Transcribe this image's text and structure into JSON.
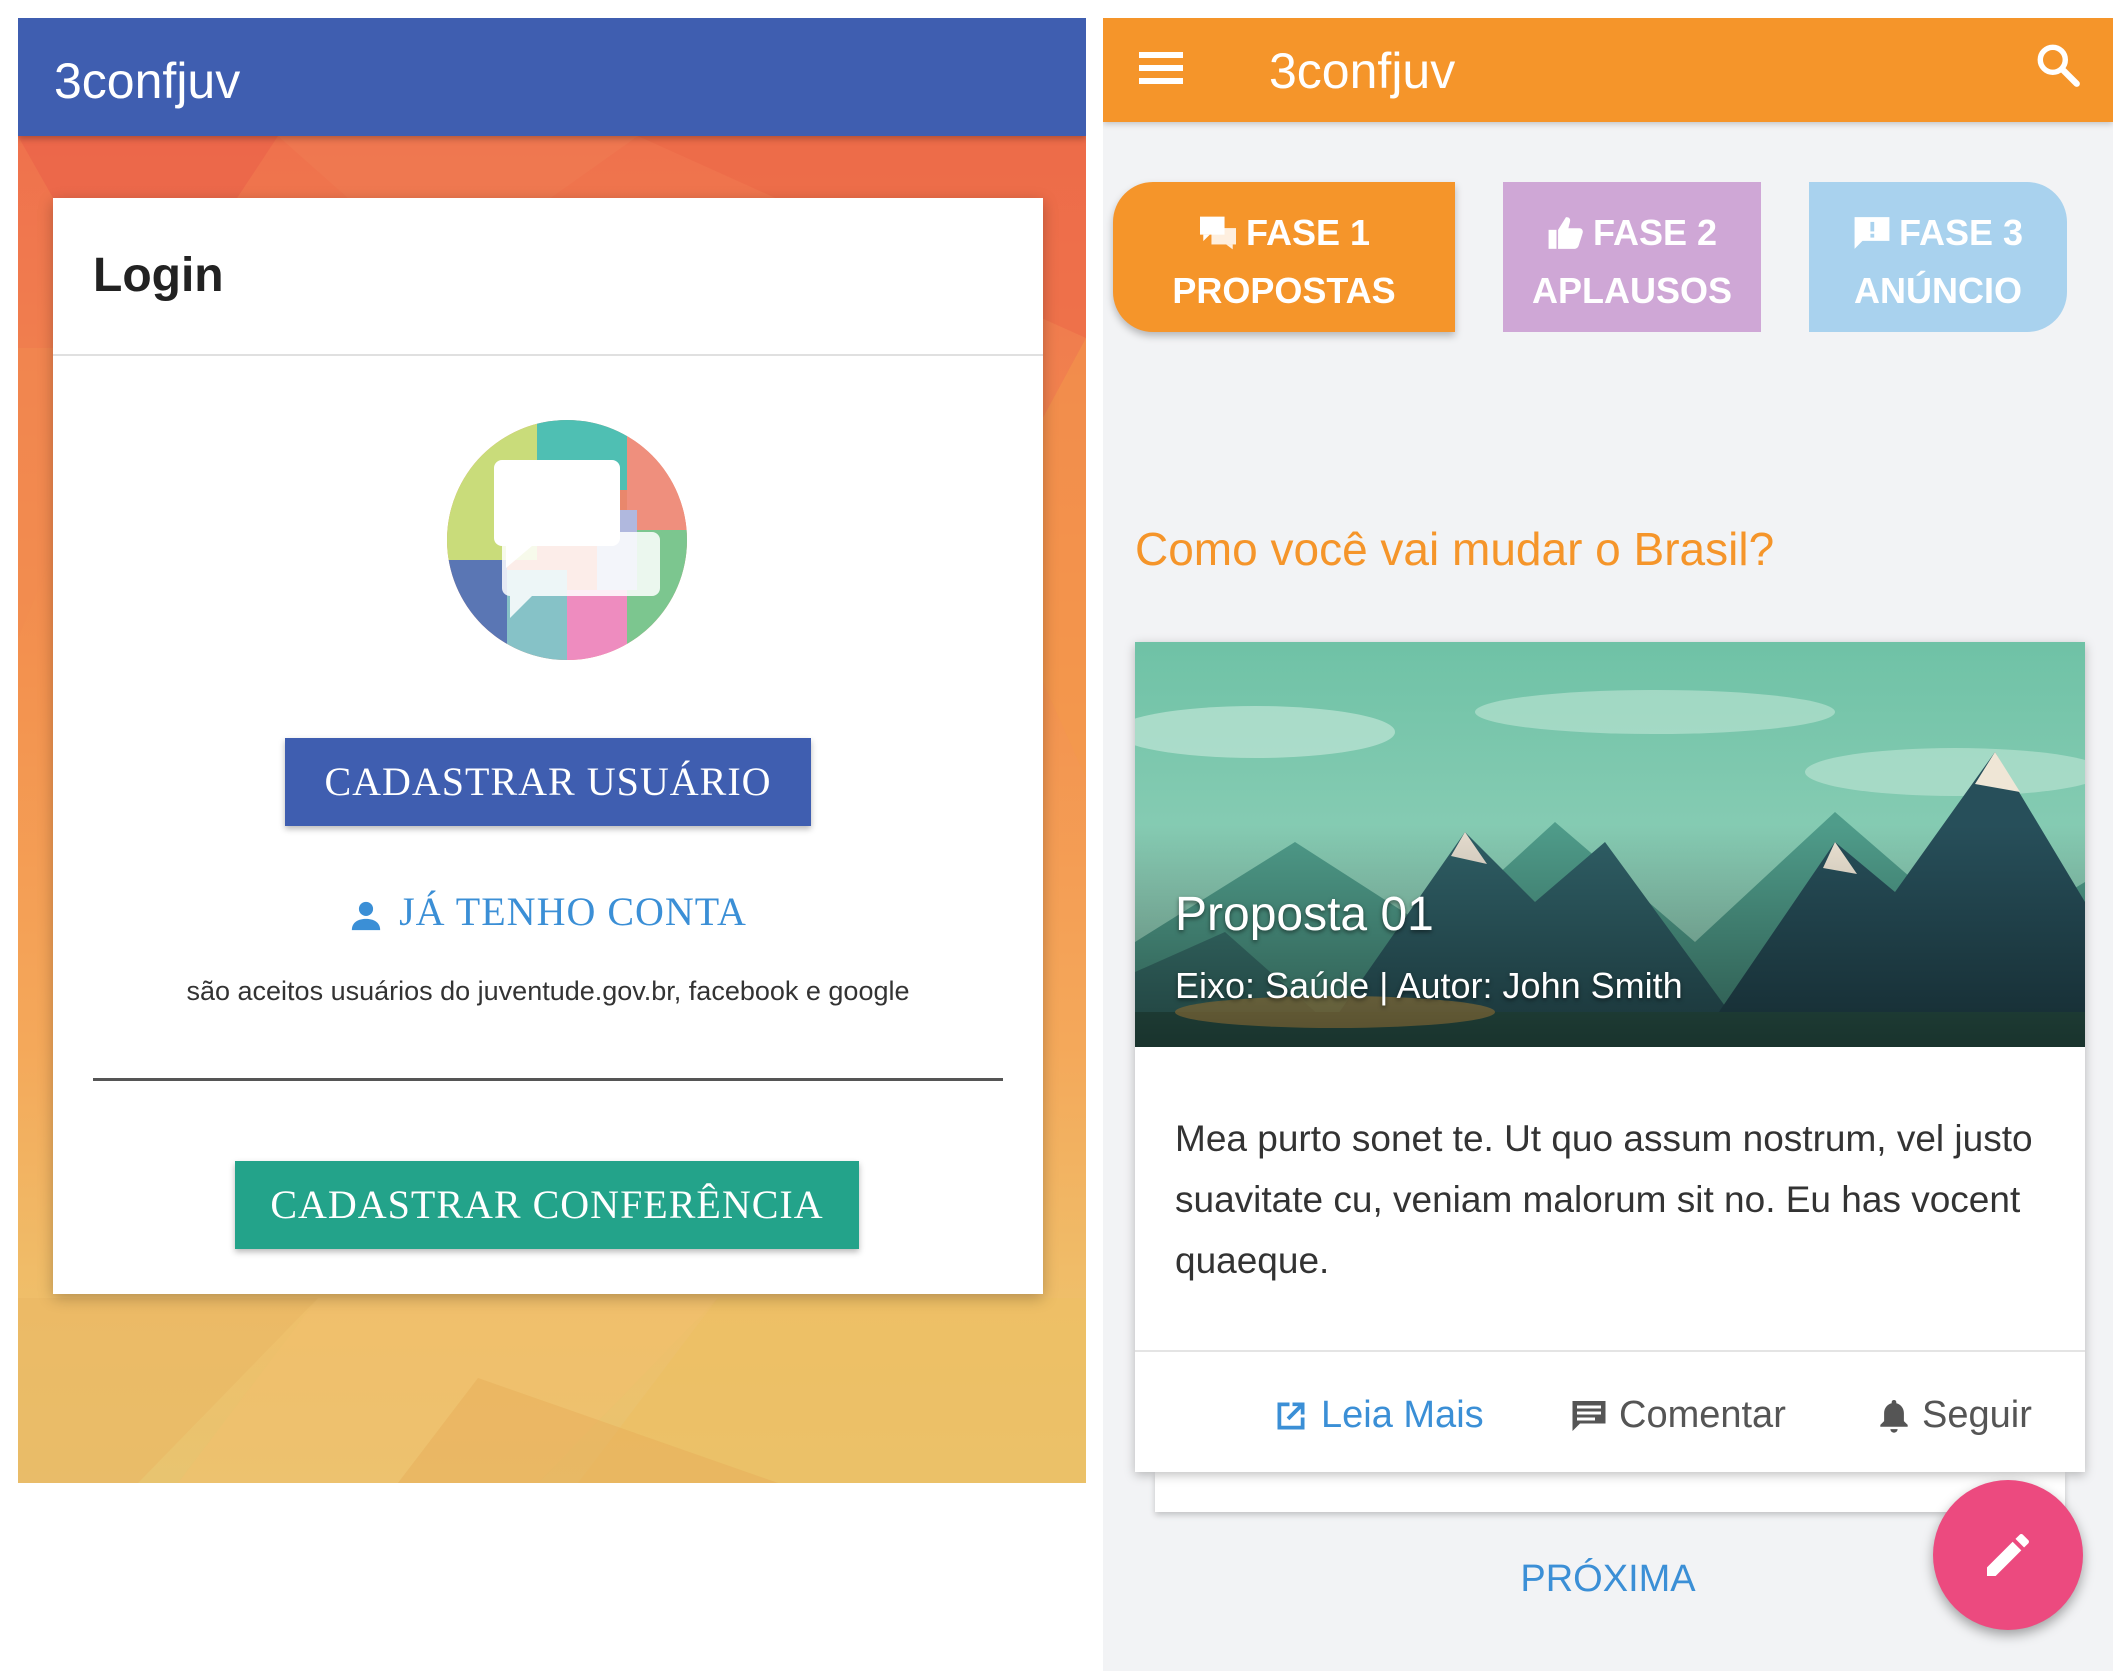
{
  "login_screen": {
    "app_title": "3confjuv",
    "card_title": "Login",
    "register_user_button": "CADASTRAR  USUÁRIO",
    "have_account_link": "JÁ  TENHO  CONTA",
    "accepted_accounts_note": "são aceitos usuários do juventude.gov.br, facebook e google",
    "register_conference_button": "CADASTRAR  CONFERÊNCIA",
    "colors": {
      "appbar": "#3f5eb0",
      "register_user": "#3f5eb0",
      "register_conference": "#23a38a",
      "link": "#3b8fd6"
    }
  },
  "feed_screen": {
    "app_title": "3confjuv",
    "icons": {
      "menu": "menu-icon",
      "search": "search-icon"
    },
    "phases": [
      {
        "line1": "FASE 1",
        "line2": "PROPOSTAS",
        "icon": "chat-icon",
        "color": "#f5952a",
        "active": true
      },
      {
        "line1": "FASE 2",
        "line2": "APLAUSOS",
        "icon": "thumbs-up-icon",
        "color": "#cfa7d6",
        "active": false
      },
      {
        "line1": "FASE 3",
        "line2": "ANÚNCIO",
        "icon": "announcement-icon",
        "color": "#a9d2ee",
        "active": false
      }
    ],
    "question": "Como você vai mudar o Brasil?",
    "proposal": {
      "title": "Proposta 01",
      "subtitle": "Eixo: Saúde | Autor: John Smith",
      "body": "Mea purto sonet te. Ut quo assum nostrum, vel justo suavitate cu, veniam malorum sit no. Eu has vocent quaeque.",
      "actions": {
        "read_more": "Leia Mais",
        "comment": "Comentar",
        "follow": "Seguir"
      }
    },
    "next_link": "PRÓXIMA",
    "colors": {
      "appbar": "#f5952a",
      "question": "#f5952a",
      "fab": "#ec4a7f"
    }
  }
}
